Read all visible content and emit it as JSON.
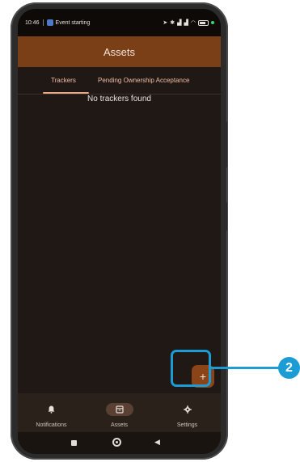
{
  "status_bar": {
    "time": "10:46",
    "notification": "Event starting",
    "icons": [
      "location-icon",
      "bluetooth-icon",
      "signal-icon",
      "signal-icon",
      "wifi-icon",
      "battery-icon",
      "green-dot"
    ]
  },
  "app_bar": {
    "title": "Assets"
  },
  "tabs": [
    {
      "label": "Trackers",
      "selected": true
    },
    {
      "label": "Pending Ownership Acceptance",
      "selected": false
    }
  ],
  "empty_message": "No trackers found",
  "fab": {
    "icon": "plus-icon",
    "glyph": "+"
  },
  "callout": {
    "number": "2",
    "color": "#1b9cd4"
  },
  "bottom_nav": [
    {
      "label": "Notifications",
      "icon": "bell-icon",
      "glyph": "🔔",
      "selected": false
    },
    {
      "label": "Assets",
      "icon": "archive-box-icon",
      "glyph": "🗃",
      "selected": true
    },
    {
      "label": "Settings",
      "icon": "gear-icon",
      "glyph": "⚙",
      "selected": false
    }
  ],
  "system_nav": {
    "back_glyph": "◀"
  },
  "colors": {
    "app_bar": "#7a3f16",
    "background": "#1f1814",
    "accent": "#e8a989",
    "fab": "#8a4417"
  }
}
